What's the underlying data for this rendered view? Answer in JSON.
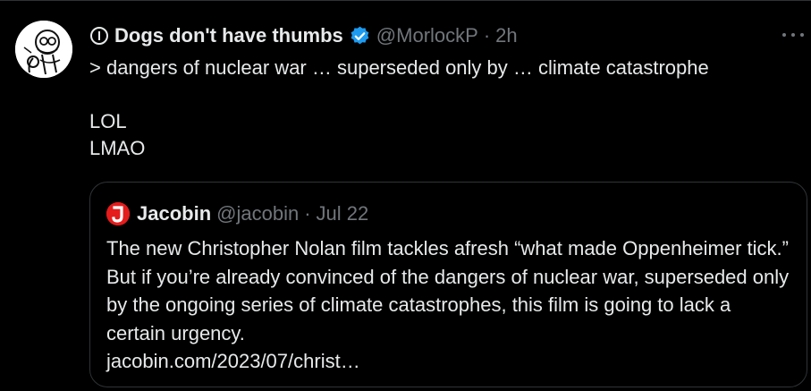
{
  "tweet": {
    "display_name": "Dogs don't have thumbs",
    "handle": "@MorlockP",
    "separator": "·",
    "time": "2h",
    "lines": [
      "> dangers of nuclear war … superseded only by … climate catastrophe",
      "",
      "LOL",
      "LMAO"
    ],
    "icons": {
      "name_emoji": "circle-exclamation-icon",
      "verified": "verified-badge-icon",
      "more": "more-options-icon"
    }
  },
  "quote": {
    "display_name": "Jacobin",
    "handle": "@jacobin",
    "separator": "·",
    "time": "Jul 22",
    "text": "The new Christopher Nolan film tackles afresh “what made Oppenheimer tick.” But if you’re already convinced of the dangers of nuclear war, superseded only by the ongoing series of climate catastrophes, this film is going to lack a certain urgency.",
    "link": "jacobin.com/2023/07/christ…"
  },
  "colors": {
    "background": "#000000",
    "text_primary": "#e7e9ea",
    "text_secondary": "#71767b",
    "border": "#2f3336",
    "verified_blue": "#1d9bf0",
    "jacobin_red": "#e41c1c"
  }
}
